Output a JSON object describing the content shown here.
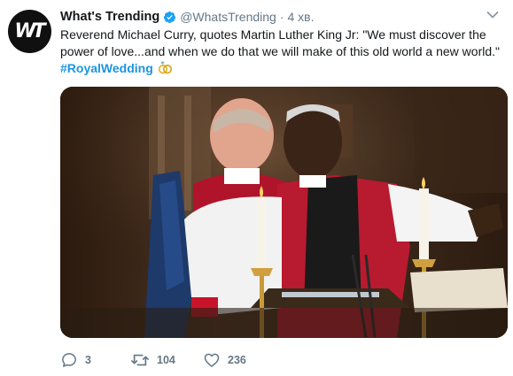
{
  "tweet": {
    "author_name": "What's Trending",
    "handle": "@WhatsTrending",
    "separator": "·",
    "time": "4 хв.",
    "avatar_text": "WT",
    "text_line1": "Reverend Michael Curry, quotes Martin Luther King Jr: \"We must discover the",
    "text_line2": "power of love...and when we do that we will make of this old world a new world.\"",
    "hashtag": "#RoyalWedding",
    "icons": {
      "verified": "verified-badge-icon",
      "caret": "chevron-down-icon",
      "hashtag_emoji": "wedding-rings-icon",
      "reply": "reply-icon",
      "retweet": "retweet-icon",
      "like": "heart-icon"
    },
    "colors": {
      "link": "#1b95e0",
      "meta": "#657786",
      "text": "#14171a"
    }
  },
  "actions": {
    "replies": "3",
    "retweets": "104",
    "likes": "236"
  }
}
